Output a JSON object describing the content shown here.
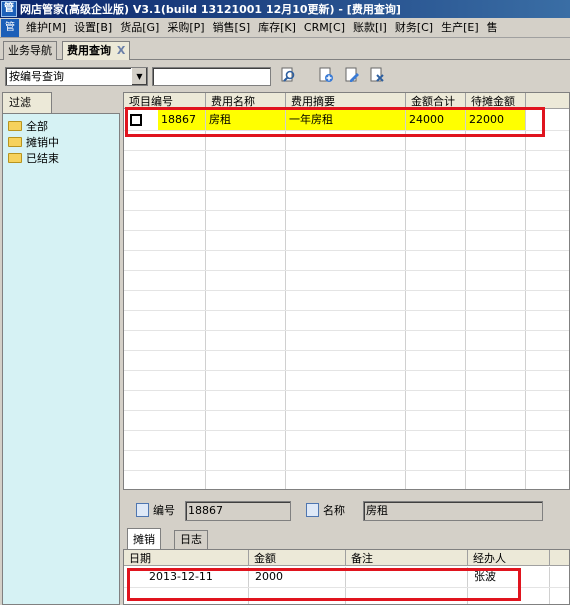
{
  "window": {
    "title": "网店管家(高级企业版) V3.1(build 13121001 12月10更新) - [费用查询]",
    "app_icon": "管"
  },
  "menubar": {
    "icon": "管",
    "items": [
      "维护[M]",
      "设置[B]",
      "货品[G]",
      "采购[P]",
      "销售[S]",
      "库存[K]",
      "CRM[C]",
      "账款[I]",
      "财务[C]",
      "生产[E]",
      "售"
    ]
  },
  "doc_tabs": {
    "nav": "业务导航",
    "current": "费用查询",
    "close": "X"
  },
  "toolbar": {
    "query_mode": "按编号查询",
    "search_value": "",
    "icons": [
      "search-icon",
      "add-icon",
      "edit-icon",
      "delete-icon"
    ]
  },
  "filter": {
    "tab_label": "过滤",
    "items": [
      "全部",
      "摊销中",
      "已结束"
    ]
  },
  "grid": {
    "columns": [
      "项目编号",
      "费用名称",
      "费用摘要",
      "金额合计",
      "待摊金额"
    ],
    "rows": [
      {
        "checked": false,
        "id": "18867",
        "name": "房租",
        "summary": "一年房租",
        "total": "24000",
        "pending": "22000"
      }
    ],
    "highlight_color": "#ffff00"
  },
  "detail": {
    "id_label": "编号",
    "id_value": "18867",
    "name_label": "名称",
    "name_value": "房租"
  },
  "sub_tabs": [
    "摊销",
    "日志"
  ],
  "sub_grid": {
    "columns": [
      "日期",
      "金额",
      "备注",
      "经办人"
    ],
    "rows": [
      {
        "date": "2013-12-11",
        "amount": "2000",
        "note": "",
        "handler": "张波"
      }
    ]
  },
  "colors": {
    "annotation": "#e0141e",
    "filter_bg": "#d6f2f4",
    "title_bar": "#0a246a"
  }
}
